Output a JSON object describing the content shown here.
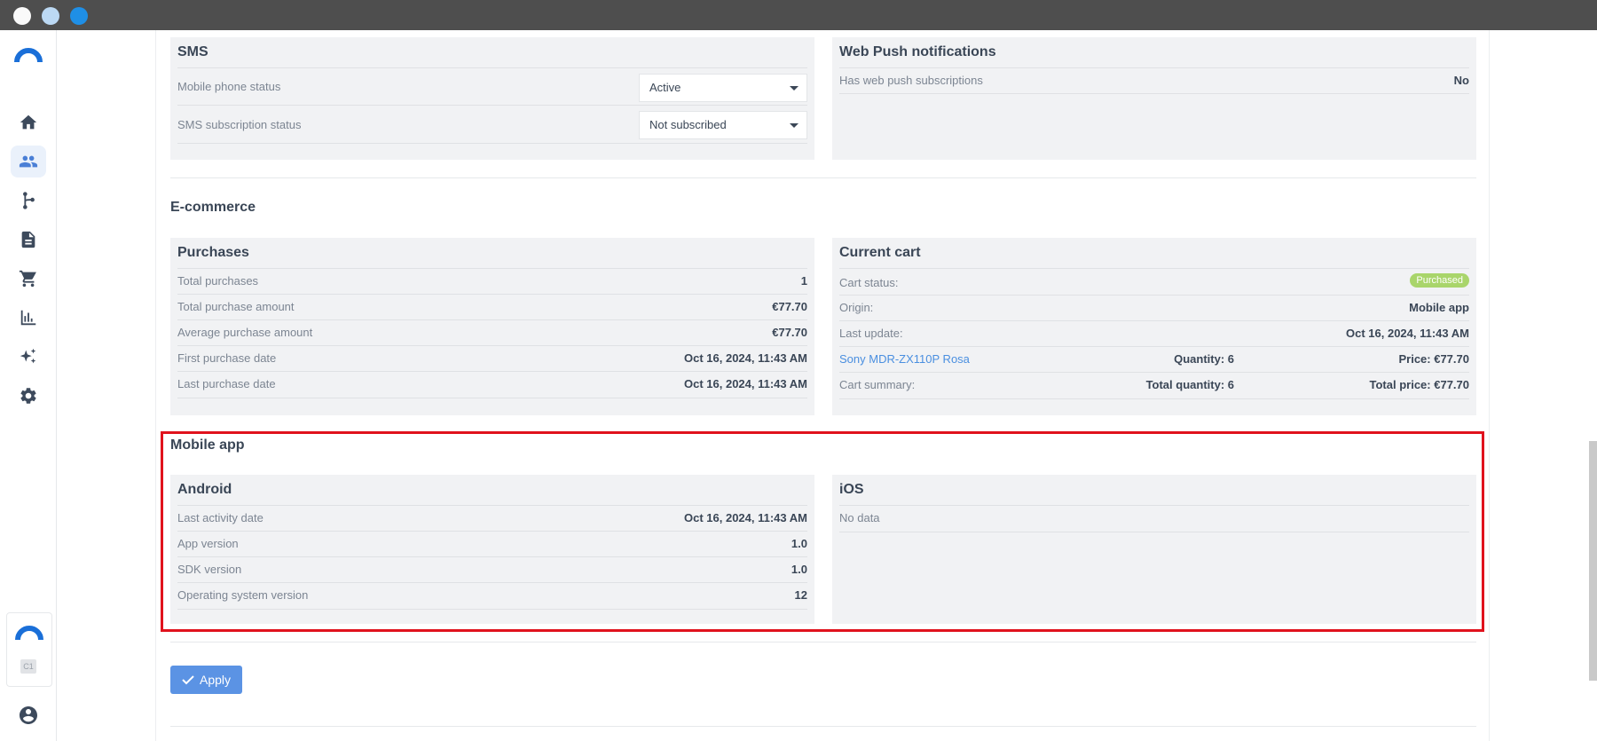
{
  "sms": {
    "title": "SMS",
    "mobile_phone_status_label": "Mobile phone status",
    "mobile_phone_status_value": "Active",
    "sms_subscription_label": "SMS subscription status",
    "sms_subscription_value": "Not subscribed"
  },
  "web_push": {
    "title": "Web Push notifications",
    "has_subscriptions_label": "Has web push subscriptions",
    "has_subscriptions_value": "No"
  },
  "ecommerce": {
    "section_title": "E-commerce",
    "purchases": {
      "title": "Purchases",
      "rows": [
        {
          "label": "Total purchases",
          "value": "1"
        },
        {
          "label": "Total purchase amount",
          "value": "€77.70"
        },
        {
          "label": "Average purchase amount",
          "value": "€77.70"
        },
        {
          "label": "First purchase date",
          "value": "Oct 16, 2024, 11:43 AM"
        },
        {
          "label": "Last purchase date",
          "value": "Oct 16, 2024, 11:43 AM"
        }
      ]
    },
    "cart": {
      "title": "Current cart",
      "status_label": "Cart status:",
      "status_badge": "Purchased",
      "origin_label": "Origin:",
      "origin_value": "Mobile app",
      "last_update_label": "Last update:",
      "last_update_value": "Oct 16, 2024, 11:43 AM",
      "item_name": "Sony MDR-ZX110P Rosa",
      "item_quantity": "Quantity: 6",
      "item_price": "Price: €77.70",
      "summary_label": "Cart summary:",
      "summary_quantity": "Total quantity: 6",
      "summary_price": "Total price: €77.70"
    }
  },
  "mobile_app": {
    "section_title": "Mobile app",
    "android": {
      "title": "Android",
      "rows": [
        {
          "label": "Last activity date",
          "value": "Oct 16, 2024, 11:43 AM"
        },
        {
          "label": "App version",
          "value": "1.0"
        },
        {
          "label": "SDK version",
          "value": "1.0"
        },
        {
          "label": "Operating system version",
          "value": "12"
        }
      ]
    },
    "ios": {
      "title": "iOS",
      "empty_text": "No data"
    }
  },
  "apply_label": "Apply",
  "rail": {
    "account_badge": "C1",
    "items": [
      "home-icon",
      "people-icon",
      "flow-icon",
      "document-icon",
      "cart-icon",
      "chart-icon",
      "sparkle-icon",
      "gear-icon"
    ]
  },
  "colors": {
    "accent": "#5b93e4",
    "highlight": "#e0121d",
    "badge": "#a9d56b",
    "link": "#4a8fe0"
  }
}
